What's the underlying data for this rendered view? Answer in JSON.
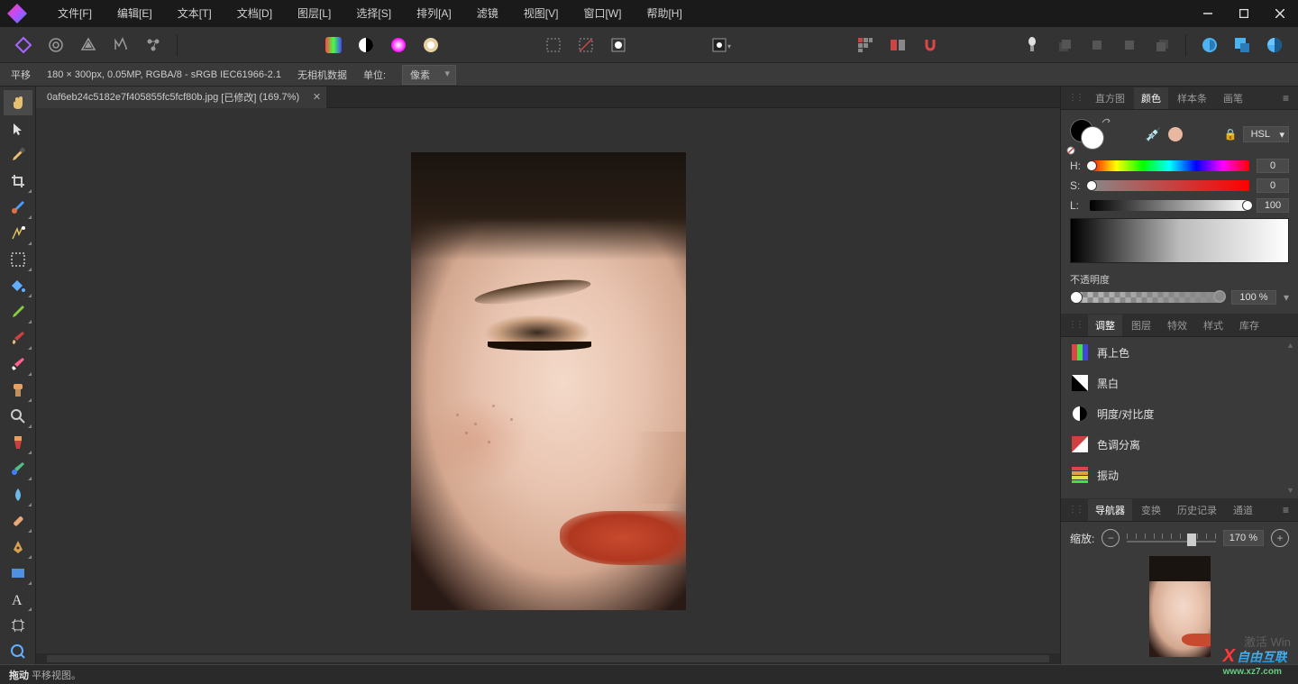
{
  "menu": [
    "文件[F]",
    "编辑[E]",
    "文本[T]",
    "文档[D]",
    "图层[L]",
    "选择[S]",
    "排列[A]",
    "滤镜",
    "视图[V]",
    "窗口[W]",
    "帮助[H]"
  ],
  "context": {
    "tool": "平移",
    "info": "180 × 300px, 0.05MP, RGBA/8 - sRGB IEC61966-2.1",
    "camera": "无相机数据",
    "unit_label": "单位:",
    "unit_value": "像素"
  },
  "document": {
    "filename": "0af6eb24c5182e7f405855fc5fcf80b.jpg",
    "modified": "[已修改]",
    "zoom": "(169.7%)"
  },
  "panels": {
    "color_tabs": [
      "直方图",
      "颜色",
      "样本条",
      "画笔"
    ],
    "color_active": 1,
    "color_mode": "HSL",
    "hsl": {
      "H_label": "H:",
      "H_val": "0",
      "S_label": "S:",
      "S_val": "0",
      "L_label": "L:",
      "L_val": "100"
    },
    "opacity_label": "不透明度",
    "opacity_val": "100 %",
    "adjust_tabs": [
      "调整",
      "图层",
      "特效",
      "样式",
      "库存"
    ],
    "adjust_active": 0,
    "adjustments": [
      "再上色",
      "黑白",
      "明度/对比度",
      "色调分离",
      "振动"
    ],
    "nav_tabs": [
      "导航器",
      "变换",
      "历史记录",
      "通道"
    ],
    "nav_active": 0,
    "zoom_label": "缩放:",
    "zoom_val": "170 %"
  },
  "status": {
    "action": "拖动",
    "hint": "平移视图。"
  },
  "watermark": {
    "brand": "自由互联",
    "url": "www.xz7.com"
  },
  "activate_hint": "激活 Win"
}
